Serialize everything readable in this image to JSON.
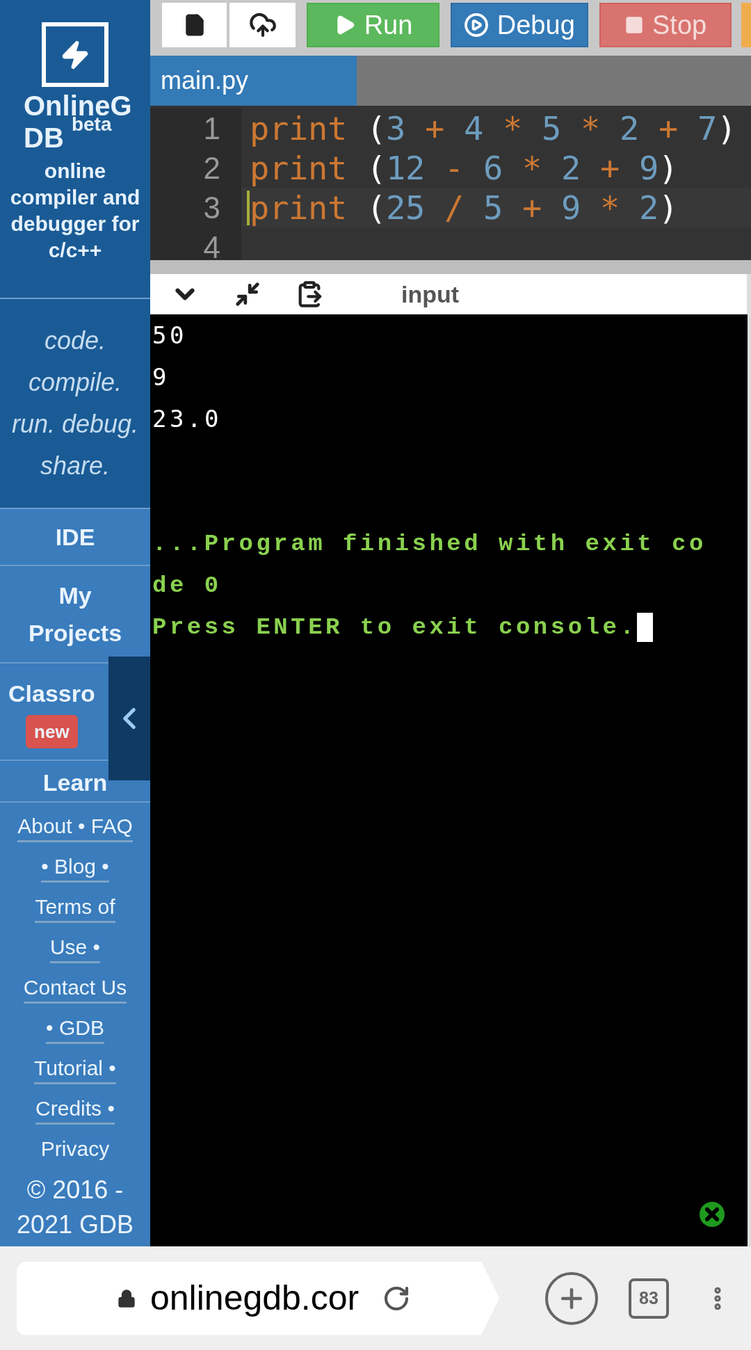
{
  "sidebar": {
    "logo": {
      "title": "OnlineGDB $^{beta}$"
    },
    "subtitle": "online compiler and debugger for c/c++",
    "tagline": "code. compile. run. debug. share.",
    "nav": [
      {
        "label": "IDE"
      },
      {
        "label": "My Projects"
      },
      {
        "label": "Classro",
        "badge": "new"
      },
      {
        "label": "Learn"
      }
    ],
    "footer_links": [
      {
        "text": "About • FAQ",
        "underlined": true
      },
      {
        "text": "• Blog •",
        "underlined": true
      },
      {
        "text": "Terms of",
        "underlined": true
      },
      {
        "text": "Use •",
        "underlined": true
      },
      {
        "text": "Contact Us",
        "underlined": true
      },
      {
        "text": "• GDB",
        "underlined": true
      },
      {
        "text": "Tutorial •",
        "underlined": true
      },
      {
        "text": "Credits •",
        "underlined": true
      },
      {
        "text": "Privacy",
        "underlined": false
      }
    ],
    "copyright": "© 2016 - 2021 GDB"
  },
  "toolbar": {
    "buttons": [
      {
        "kind": "new-file"
      },
      {
        "kind": "upload"
      },
      {
        "kind": "run",
        "label": "Run"
      },
      {
        "kind": "debug",
        "label": "Debug"
      },
      {
        "kind": "stop",
        "label": "Stop"
      },
      {
        "kind": "partial"
      }
    ]
  },
  "editor": {
    "tabs": [
      {
        "label": "main.py",
        "selected": true
      }
    ],
    "lines": [
      {
        "number": "1",
        "code": "print (3 + 4 * 5 * 2 + 7)",
        "active": false
      },
      {
        "number": "2",
        "code": "print (12 - 6 * 2 + 9)",
        "active": false
      },
      {
        "number": "3",
        "code": "print (25 / 5 + 9 * 2)",
        "active": true
      },
      {
        "number": "4",
        "active": false
      }
    ]
  },
  "console": {
    "header": {
      "label": "input"
    },
    "lines": [
      {
        "kind": "output",
        "text": "50"
      },
      {
        "kind": "output",
        "text": "9"
      },
      {
        "kind": "output",
        "text": "23.0"
      },
      {
        "kind": "status",
        "text": "...Program finished with exit code 0"
      },
      {
        "kind": "status",
        "text": "Press ENTER to exit console.",
        "cursor": true
      }
    ]
  },
  "browser": {
    "url": "onlinegdb.cor",
    "tab_count": "83"
  }
}
